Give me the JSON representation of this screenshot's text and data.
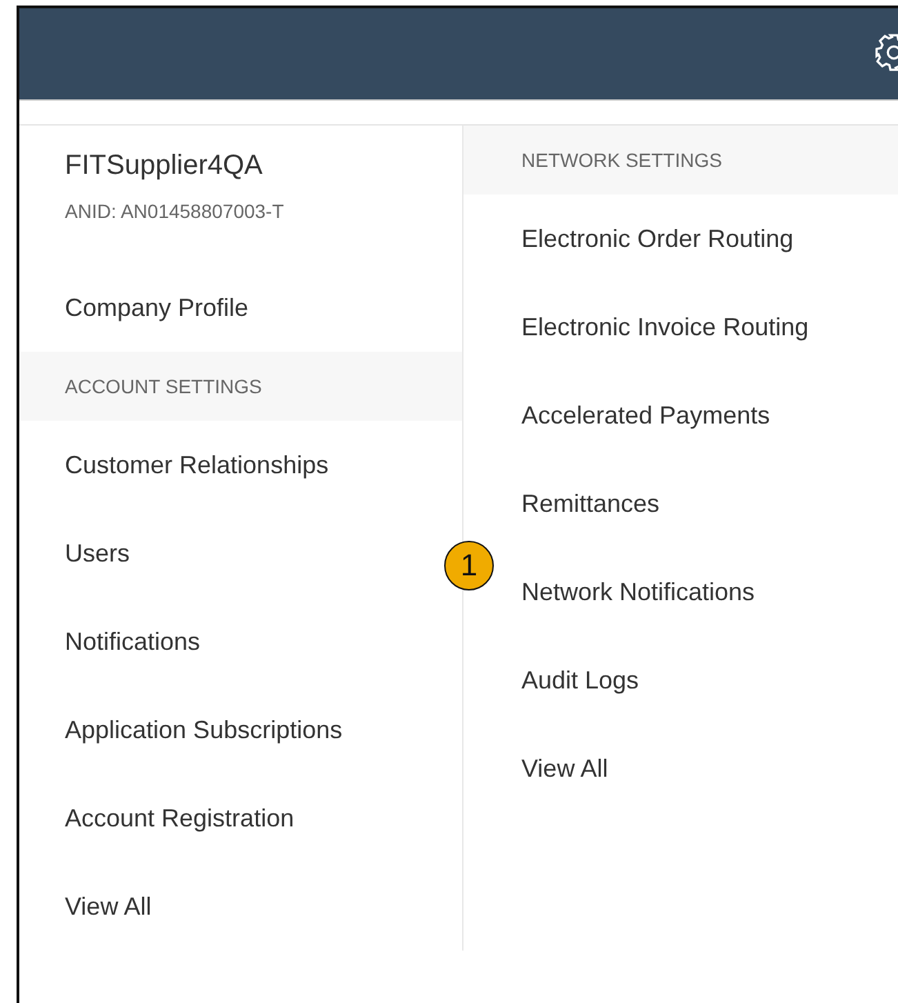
{
  "account": {
    "name": "FITSupplier4QA",
    "anid": "ANID: AN01458807003-T",
    "profile_link": "Company Profile"
  },
  "account_settings": {
    "heading": "ACCOUNT SETTINGS",
    "items": [
      "Customer Relationships",
      "Users",
      "Notifications",
      "Application Subscriptions",
      "Account Registration",
      "View All"
    ]
  },
  "network_settings": {
    "heading": "NETWORK SETTINGS",
    "items": [
      "Electronic Order Routing",
      "Electronic Invoice Routing",
      "Accelerated Payments",
      "Remittances",
      "Network Notifications",
      "Audit Logs",
      "View All"
    ]
  },
  "callout": {
    "label": "1"
  }
}
